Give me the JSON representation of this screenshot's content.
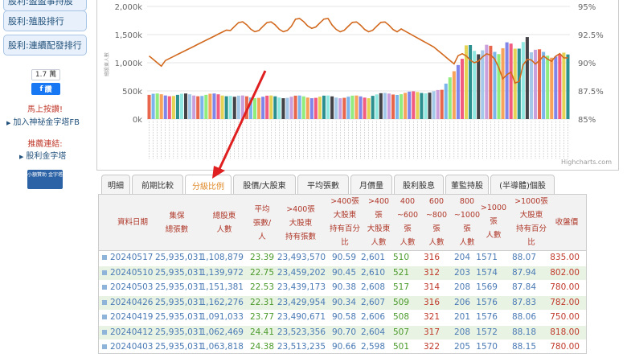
{
  "sidebar": {
    "btn_top": "股利:盈盈事持股",
    "btn_rank": "股利:殖股排行",
    "btn_consec": "股利:連續配發排行",
    "fb_count": "1.7 萬",
    "fb_like": "讚",
    "join_cta": "馬上按讚!",
    "join_link": "加入神祕金字塔FB",
    "recommend_cta": "推薦連結:",
    "pyramid_link": "股利金字塔",
    "small_btn": "小額贊助 金字塔"
  },
  "chart": {
    "credit": "Highcharts.com",
    "y_ticks_left": [
      "0k",
      "500k",
      "1,000k",
      "1,500k",
      "2,000k"
    ],
    "y_ticks_right": [
      "85%",
      "87.5%",
      "90%",
      "92.5%",
      "95%"
    ],
    "y_axis_left_label": "總股東人數",
    "line_color": "#d2691e",
    "bar_colors": [
      "#e8674c",
      "#7cb5ec",
      "#90ed7d",
      "#f7a35c",
      "#8085e9",
      "#f15c80",
      "#e4d354",
      "#2b908f",
      "#91e8e1",
      "#434348",
      "#a4c8e8",
      "#c9a0dc"
    ]
  },
  "tabs": [
    "明細",
    "前期比較",
    "分級比例",
    "股價/大股東",
    "平均張數",
    "月價量",
    "股利股息",
    "董監持股",
    "(半導體)個股"
  ],
  "active_tab": "分級比例",
  "table": {
    "headers": {
      "date": "資料日期",
      "jibao": "集保\n總張數",
      "holders": "總股東\n人數",
      "avg": "平均\n張數/\n人",
      "gt400": ">400張\n大股東\n持有張數",
      "gt400pct": ">400張\n大股東\n持有百分\n比",
      "gt400n": ">400\n張\n大股東\n人數",
      "r400_600": "400\n~600\n張\n人數",
      "r600_800": "600\n~800\n張\n人數",
      "r800_1000": "800\n~1000\n張\n人數",
      "gt1000n": ">1000\n張\n人數",
      "gt1000pct": ">1000張\n大股東\n持有百分\n比",
      "close": "收盤價"
    },
    "rows": [
      [
        "20240517",
        "25,935,031",
        "1,108,879",
        "23.39",
        "23,493,570",
        "90.59",
        "2,601",
        "510",
        "316",
        "204",
        "1571",
        "88.07",
        "835.00"
      ],
      [
        "20240510",
        "25,935,031",
        "1,139,972",
        "22.75",
        "23,459,202",
        "90.45",
        "2,610",
        "521",
        "312",
        "203",
        "1574",
        "87.94",
        "802.00"
      ],
      [
        "20240503",
        "25,935,031",
        "1,151,381",
        "22.53",
        "23,439,173",
        "90.38",
        "2,608",
        "517",
        "314",
        "208",
        "1569",
        "87.84",
        "780.00"
      ],
      [
        "20240426",
        "25,935,031",
        "1,162,276",
        "22.31",
        "23,429,954",
        "90.34",
        "2,607",
        "509",
        "316",
        "206",
        "1576",
        "87.83",
        "782.00"
      ],
      [
        "20240419",
        "25,935,031",
        "1,091,033",
        "23.77",
        "23,490,671",
        "90.58",
        "2,606",
        "508",
        "321",
        "201",
        "1576",
        "88.06",
        "750.00"
      ],
      [
        "20240412",
        "25,935,031",
        "1,062,469",
        "24.41",
        "23,523,356",
        "90.70",
        "2,604",
        "507",
        "317",
        "208",
        "1572",
        "88.18",
        "818.00"
      ],
      [
        "20240403",
        "25,935,031",
        "1,063,818",
        "24.38",
        "23,513,235",
        "90.66",
        "2,598",
        "501",
        "322",
        "205",
        "1570",
        "88.15",
        "780.00"
      ]
    ]
  }
}
